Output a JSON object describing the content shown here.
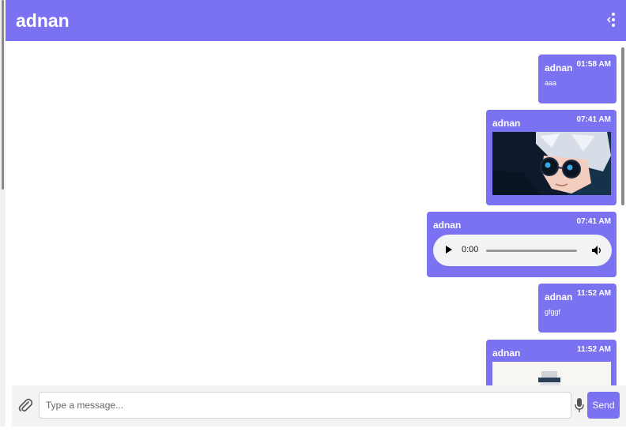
{
  "header": {
    "title": "adnan",
    "menu_icon": "vertical-dots-icon"
  },
  "theme": {
    "accent": "#7a72f0",
    "bubble_text": "#ffffff"
  },
  "messages": [
    {
      "sender": "adnan",
      "time": "01:58 AM",
      "type": "text",
      "text": "aaa"
    },
    {
      "sender": "adnan",
      "time": "07:41 AM",
      "type": "image",
      "image_desc": "anime-character-with-sunglasses"
    },
    {
      "sender": "adnan",
      "time": "07:41 AM",
      "type": "audio",
      "audio_time": "0:00"
    },
    {
      "sender": "adnan",
      "time": "11:52 AM",
      "type": "text",
      "text": "gfggf"
    },
    {
      "sender": "adnan",
      "time": "11:52 AM",
      "type": "image",
      "image_desc": "product-photo"
    }
  ],
  "composer": {
    "placeholder": "Type a message...",
    "value": "",
    "send_label": "Send",
    "attach_icon": "paperclip-icon",
    "mic_icon": "microphone-icon"
  }
}
